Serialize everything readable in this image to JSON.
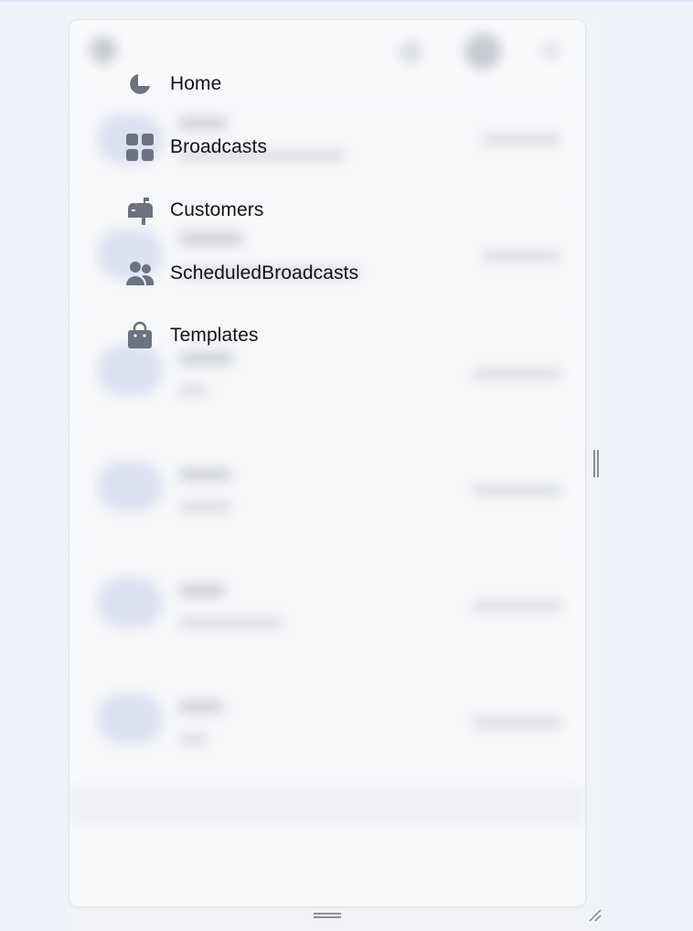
{
  "menu": {
    "items": [
      {
        "label": "Home",
        "icon": "pie-chart-icon"
      },
      {
        "label": "Broadcasts",
        "icon": "grid-icon"
      },
      {
        "label": "Customers",
        "icon": "mailbox-icon"
      },
      {
        "label": "ScheduledBroadcasts",
        "icon": "users-icon"
      },
      {
        "label": "Templates",
        "icon": "shopping-bag-icon"
      }
    ]
  },
  "colors": {
    "icon": "#6b7280",
    "page_background": "#eef2fb",
    "panel_background": "#f8f9fb",
    "text": "#111318"
  }
}
